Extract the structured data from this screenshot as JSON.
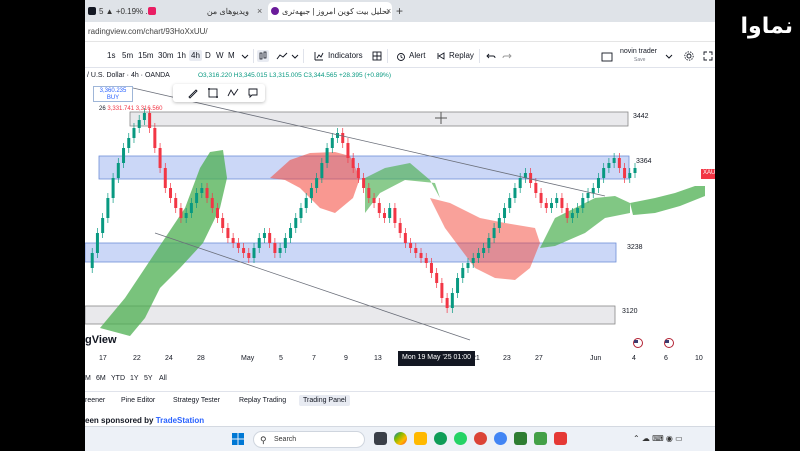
{
  "browser": {
    "tabs": [
      {
        "label": "5  ▲ +0.19% ..."
      },
      {
        "label": "ویدیوهای من"
      },
      {
        "label": "تحلیل بیت کوین امروز | جبهه‌تری"
      }
    ],
    "new_tab_label": "+",
    "url": "radingview.com/chart/93HoXxUU/"
  },
  "toolbar": {
    "timeframes": [
      "1s",
      "5m",
      "15m",
      "30m",
      "1h",
      "4h",
      "D",
      "W",
      "M"
    ],
    "active_timeframe": "4h",
    "indicators_label": "Indicators",
    "alert_label": "Alert",
    "replay_label": "Replay",
    "account_name": "novin trader",
    "account_status": "Save"
  },
  "legend": {
    "title": "/ U.S. Dollar · 4h · OANDA",
    "ohlc": "O3,316.220  H3,345.015  L3,315.005  C3,344.565  +28.395 (+0.89%)",
    "price_box_value": "3,360.235",
    "price_box_label": "BUY",
    "indicator_row_prefix": "26",
    "indicator_row": "3,331.741  3,316.560"
  },
  "levels": [
    {
      "label": "3442"
    },
    {
      "label": "3364"
    },
    {
      "label": "3238"
    },
    {
      "label": "3120"
    }
  ],
  "symbol_tag": "XAU",
  "chart_logo": "gView",
  "time_axis": {
    "ticks": [
      "17",
      "22",
      "24",
      "28",
      "May",
      "5",
      "7",
      "9",
      "13",
      "21",
      "23",
      "27",
      "Jun",
      "4",
      "6",
      "10"
    ],
    "crosshair_label": "Mon 19 May '25   01:00"
  },
  "ranges": [
    "M",
    "6M",
    "YTD",
    "1Y",
    "5Y",
    "All"
  ],
  "panel_tabs": [
    "reener",
    "Pine Editor",
    "Strategy Tester",
    "Replay Trading",
    "Trading Panel"
  ],
  "active_panel_tab": "Trading Panel",
  "sponsor": {
    "prefix": "een sponsored by",
    "brand": "TradeStation"
  },
  "taskbar": {
    "search_placeholder": "Search"
  },
  "colors": {
    "bull": "#089981",
    "bear": "#f23645",
    "cloud_green": "#4caf50",
    "cloud_red": "#f44336",
    "zone_blue": "#c5d3f6",
    "zone_gray": "#e9e9ec",
    "accent": "#2962ff"
  },
  "overlay_logo": "نماوا"
}
